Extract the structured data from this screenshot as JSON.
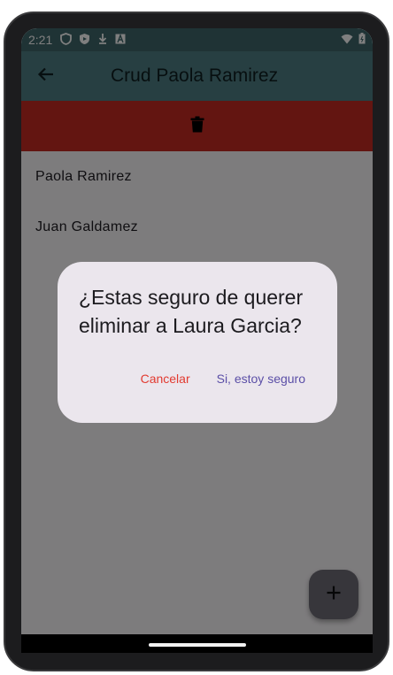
{
  "status_bar": {
    "time": "2:21",
    "icons": [
      "shield-outline-icon",
      "shield-filled-icon",
      "download-icon",
      "font-a-icon"
    ],
    "right_icons": [
      "wifi-icon",
      "battery-icon"
    ]
  },
  "app_bar": {
    "back_icon": "arrow-left-icon",
    "title": "Crud Paola Ramirez",
    "color": "#4f7f85"
  },
  "delete_strip": {
    "icon": "trash-icon",
    "color": "#c62b23"
  },
  "list": {
    "items": [
      {
        "label": "Paola Ramirez"
      },
      {
        "label": "Juan Galdamez"
      }
    ]
  },
  "dialog": {
    "message": "¿Estas seguro de querer eliminar a Laura Garcia?",
    "cancel_label": "Cancelar",
    "confirm_label": "Si, estoy seguro",
    "cancel_color": "#e23a30",
    "confirm_color": "#5b4fa7"
  },
  "fab": {
    "icon": "plus-icon",
    "label": "+"
  }
}
